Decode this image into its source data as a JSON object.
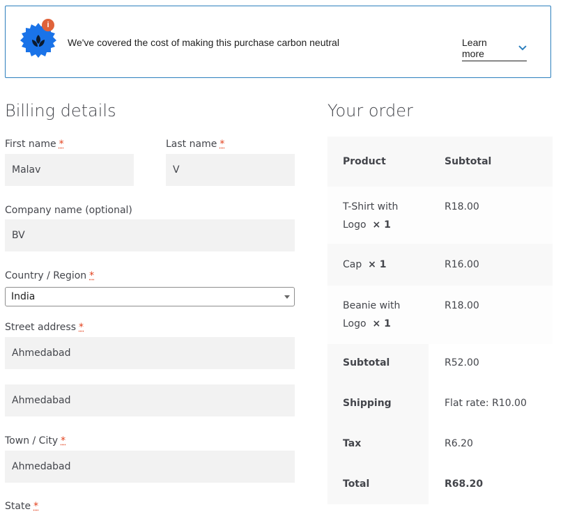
{
  "banner": {
    "info_badge": "i",
    "message": "We've covered the cost of making this purchase carbon neutral",
    "learn_more": "Learn more"
  },
  "billing": {
    "title": "Billing details",
    "required_mark": "*",
    "first_name": {
      "label": "First name",
      "value": "Malav"
    },
    "last_name": {
      "label": "Last name",
      "value": "V"
    },
    "company": {
      "label": "Company name (optional)",
      "value": "BV"
    },
    "country": {
      "label": "Country / Region",
      "value": "India"
    },
    "street": {
      "label": "Street address",
      "value1": "Ahmedabad",
      "value2": "Ahmedabad"
    },
    "town": {
      "label": "Town / City",
      "value": "Ahmedabad"
    },
    "state": {
      "label": "State"
    }
  },
  "order": {
    "title": "Your order",
    "header": {
      "product": "Product",
      "subtotal": "Subtotal"
    },
    "items": [
      {
        "name_line1": "T-Shirt with",
        "name_line2": "Logo",
        "qty": "× 1",
        "price": "R18.00"
      },
      {
        "name_line1": "Cap",
        "qty": "× 1",
        "price": "R16.00"
      },
      {
        "name_line1": "Beanie with",
        "name_line2": "Logo",
        "qty": "× 1",
        "price": "R18.00"
      }
    ],
    "totals": [
      {
        "label": "Subtotal",
        "value": "R52.00"
      },
      {
        "label": "Shipping",
        "value": "Flat rate: R10.00"
      },
      {
        "label": "Tax",
        "value": "R6.20"
      },
      {
        "label": "Total",
        "value": "R68.20"
      }
    ]
  },
  "colors": {
    "accent": "#2c7fbd",
    "badge_blue": "#1a73e8",
    "required": "#e2401c",
    "field_bg": "#f2f2f2"
  }
}
